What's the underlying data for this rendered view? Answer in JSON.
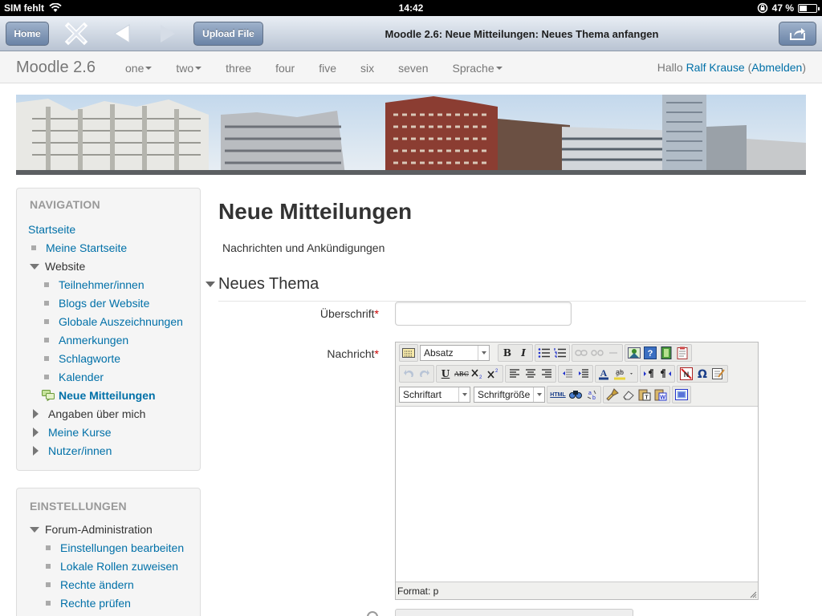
{
  "status": {
    "carrier": "SIM fehlt",
    "time": "14:42",
    "battery": "47 %",
    "battery_level": 0.47
  },
  "browser": {
    "home_label": "Home",
    "upload_label": "Upload File",
    "title": "Moodle 2.6: Neue Mitteilungen: Neues Thema anfangen"
  },
  "navbar": {
    "brand": "Moodle 2.6",
    "menu": [
      {
        "label": "one",
        "dropdown": true
      },
      {
        "label": "two",
        "dropdown": true
      },
      {
        "label": "three",
        "dropdown": false
      },
      {
        "label": "four",
        "dropdown": false
      },
      {
        "label": "five",
        "dropdown": false
      },
      {
        "label": "six",
        "dropdown": false
      },
      {
        "label": "seven",
        "dropdown": false
      },
      {
        "label": "Sprache",
        "dropdown": true
      }
    ],
    "greeting": "Hallo",
    "user": "Ralf Krause",
    "logout_open": "(",
    "logout": "Abmelden",
    "logout_close": ")"
  },
  "navigation": {
    "heading": "NAVIGATION",
    "home": "Startseite",
    "my_home": "Meine Startseite",
    "site": "Website",
    "site_items": [
      "Teilnehmer/innen",
      "Blogs der Website",
      "Globale Auszeichnungen",
      "Anmerkungen",
      "Schlagworte",
      "Kalender"
    ],
    "active": "Neue Mitteilungen",
    "profile": "Angaben über mich",
    "courses": "Meine Kurse",
    "users": "Nutzer/innen"
  },
  "settings": {
    "heading": "EINSTELLUNGEN",
    "forum_admin": "Forum-Administration",
    "items": [
      "Einstellungen bearbeiten",
      "Lokale Rollen zuweisen",
      "Rechte ändern",
      "Rechte prüfen"
    ]
  },
  "main": {
    "title": "Neue Mitteilungen",
    "description": "Nachrichten und Ankündigungen",
    "legend": "Neues Thema",
    "subject_label": "Überschrift",
    "message_label": "Nachricht",
    "required_mark": "*"
  },
  "editor": {
    "paragraph_select": "Absatz",
    "font_select": "Schriftart",
    "size_select": "Schriftgröße",
    "bold": "B",
    "italic": "I",
    "underline": "U",
    "strike": "ABC",
    "html_label": "HTML",
    "status": "Format: p"
  },
  "colors": {
    "link": "#0070a8",
    "required": "#cc0000",
    "heading_grey": "#999999"
  }
}
